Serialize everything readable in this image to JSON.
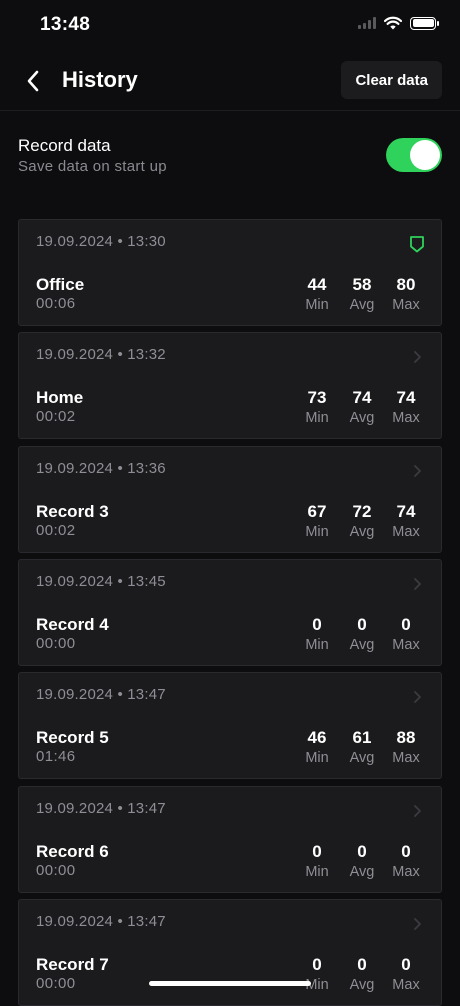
{
  "status_bar": {
    "time": "13:48"
  },
  "nav": {
    "title": "History",
    "clear_label": "Clear data"
  },
  "setting": {
    "title": "Record data",
    "subtitle": "Save data on start up",
    "enabled": true
  },
  "stat_labels": {
    "min": "Min",
    "avg": "Avg",
    "max": "Max"
  },
  "records": [
    {
      "date": "19.09.2024 • 13:30",
      "name": "Office",
      "duration": "00:06",
      "min": "44",
      "avg": "58",
      "max": "80",
      "icon": "shield-icon"
    },
    {
      "date": "19.09.2024 • 13:32",
      "name": "Home",
      "duration": "00:02",
      "min": "73",
      "avg": "74",
      "max": "74",
      "icon": "chevron-right-icon"
    },
    {
      "date": "19.09.2024 • 13:36",
      "name": "Record 3",
      "duration": "00:02",
      "min": "67",
      "avg": "72",
      "max": "74",
      "icon": "chevron-right-icon"
    },
    {
      "date": "19.09.2024 • 13:45",
      "name": "Record 4",
      "duration": "00:00",
      "min": "0",
      "avg": "0",
      "max": "0",
      "icon": "chevron-right-icon"
    },
    {
      "date": "19.09.2024 • 13:47",
      "name": "Record 5",
      "duration": "01:46",
      "min": "46",
      "avg": "61",
      "max": "88",
      "icon": "chevron-right-icon"
    },
    {
      "date": "19.09.2024 • 13:47",
      "name": "Record 6",
      "duration": "00:00",
      "min": "0",
      "avg": "0",
      "max": "0",
      "icon": "chevron-right-icon"
    },
    {
      "date": "19.09.2024 • 13:47",
      "name": "Record 7",
      "duration": "00:00",
      "min": "0",
      "avg": "0",
      "max": "0",
      "icon": "chevron-right-icon"
    }
  ],
  "colors": {
    "accent": "#2fd25b",
    "background": "#0d0d0f",
    "card": "#1b1b1e"
  }
}
